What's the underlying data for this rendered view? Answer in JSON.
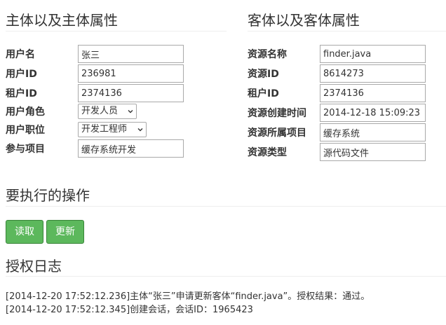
{
  "subject": {
    "title": "主体以及主体属性",
    "fields": {
      "username": {
        "label": "用户名",
        "value": "张三"
      },
      "user_id": {
        "label": "用户ID",
        "value": "236981"
      },
      "tenant_id": {
        "label": "租户ID",
        "value": "2374136"
      },
      "role": {
        "label": "用户角色",
        "value": "开发人员"
      },
      "position": {
        "label": "用户职位",
        "value": "开发工程师"
      },
      "project": {
        "label": "参与项目",
        "value": "缓存系统开发"
      }
    }
  },
  "object": {
    "title": "客体以及客体属性",
    "fields": {
      "resource_name": {
        "label": "资源名称",
        "value": "finder.java"
      },
      "resource_id": {
        "label": "资源ID",
        "value": "8614273"
      },
      "tenant_id": {
        "label": "租户ID",
        "value": "2374136"
      },
      "created_time": {
        "label": "资源创建时间",
        "value": "2014-12-18 15:09:23"
      },
      "owner_project": {
        "label": "资源所属项目",
        "value": "缓存系统"
      },
      "resource_type": {
        "label": "资源类型",
        "value": "源代码文件"
      }
    }
  },
  "action": {
    "title": "要执行的操作",
    "read_label": "读取",
    "update_label": "更新"
  },
  "log": {
    "title": "授权日志",
    "lines": [
      "[2014-12-20 17:52:12.236]主体“张三”申请更新客体“finder.java”。授权结果：通过。",
      "[2014-12-20 17:52:12.345]创建会话，会话ID：1965423"
    ]
  },
  "colors": {
    "button_bg": "#5cb85c",
    "button_border": "#398439",
    "rule": "#eeeeee",
    "text": "#333333"
  }
}
